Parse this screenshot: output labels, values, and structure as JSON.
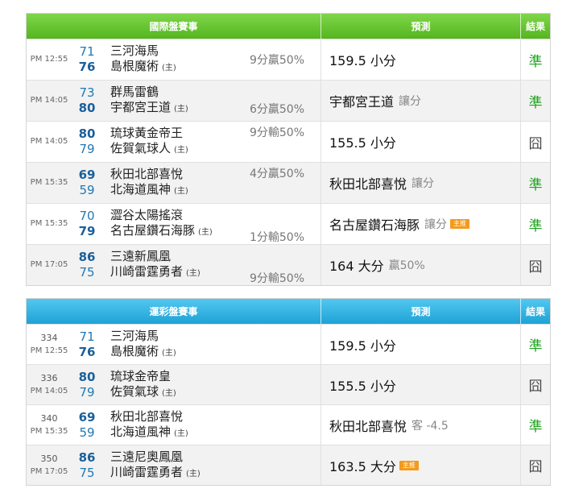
{
  "intl": {
    "header": {
      "game": "國際盤賽事",
      "pred": "預測",
      "result": "結果"
    },
    "rows": [
      {
        "time": "PM 12:55",
        "s1": "71",
        "s2": "76",
        "t1": "三河海馬",
        "t2": "島根魔術",
        "home": "(主)",
        "margin": "9分贏50%",
        "pred": "159.5 小分",
        "extra": "",
        "badge": "",
        "result": "準",
        "hit": true
      },
      {
        "time": "PM 14:05",
        "s1": "73",
        "s2": "80",
        "t1": "群馬雷鶴",
        "t2": "宇都宮王道",
        "home": "(主)",
        "margin": "6分贏50%",
        "pred": "宇都宮王道",
        "extra": "讓分",
        "badge": "",
        "result": "準",
        "hit": true
      },
      {
        "time": "PM 14:05",
        "s1": "80",
        "s2": "79",
        "t1": "琉球黃金帝王",
        "t2": "佐賀氣球人",
        "home": "(主)",
        "margin": "9分輸50%",
        "pred": "155.5 小分",
        "extra": "",
        "badge": "",
        "result": "囧",
        "hit": false
      },
      {
        "time": "PM 15:35",
        "s1": "69",
        "s2": "59",
        "t1": "秋田北部喜悅",
        "t2": "北海道風神",
        "home": "(主)",
        "margin": "4分贏50%",
        "pred": "秋田北部喜悅",
        "extra": "讓分",
        "badge": "",
        "result": "準",
        "hit": true
      },
      {
        "time": "PM 15:35",
        "s1": "70",
        "s2": "79",
        "t1": "澀谷太陽搖滾",
        "t2": "名古屋鑽石海豚",
        "home": "(主)",
        "margin": "1分輸50%",
        "pred": "名古屋鑽石海豚",
        "extra": "讓分",
        "badge": "主推",
        "result": "準",
        "hit": true
      },
      {
        "time": "PM 17:05",
        "s1": "86",
        "s2": "75",
        "t1": "三遠新鳳凰",
        "t2": "川崎雷霆勇者",
        "home": "(主)",
        "margin": "9分輸50%",
        "pred": "164 大分",
        "extra": "贏50%",
        "badge": "",
        "result": "囧",
        "hit": false
      }
    ]
  },
  "lottery": {
    "header": {
      "game": "運彩盤賽事",
      "pred": "預測",
      "result": "結果"
    },
    "rows": [
      {
        "num": "334",
        "time": "PM 12:55",
        "s1": "71",
        "s2": "76",
        "t1": "三河海馬",
        "t2": "島根魔術",
        "home": "(主)",
        "pred": "159.5 小分",
        "extra": "",
        "badge": "",
        "result": "準",
        "hit": true
      },
      {
        "num": "336",
        "time": "PM 14:05",
        "s1": "80",
        "s2": "79",
        "t1": "琉球金帝皇",
        "t2": "佐賀氣球",
        "home": "(主)",
        "pred": "155.5 小分",
        "extra": "",
        "badge": "",
        "result": "囧",
        "hit": false
      },
      {
        "num": "340",
        "time": "PM 15:35",
        "s1": "69",
        "s2": "59",
        "t1": "秋田北部喜悅",
        "t2": "北海道風神",
        "home": "(主)",
        "pred": "秋田北部喜悅",
        "extra": "客 -4.5",
        "badge": "",
        "result": "準",
        "hit": true
      },
      {
        "num": "350",
        "time": "PM 17:05",
        "s1": "86",
        "s2": "75",
        "t1": "三遠尼奧鳳凰",
        "t2": "川崎雷霆勇者",
        "home": "(主)",
        "pred": "163.5 大分",
        "extra": "",
        "badge": "主推",
        "result": "囧",
        "hit": false
      }
    ]
  }
}
